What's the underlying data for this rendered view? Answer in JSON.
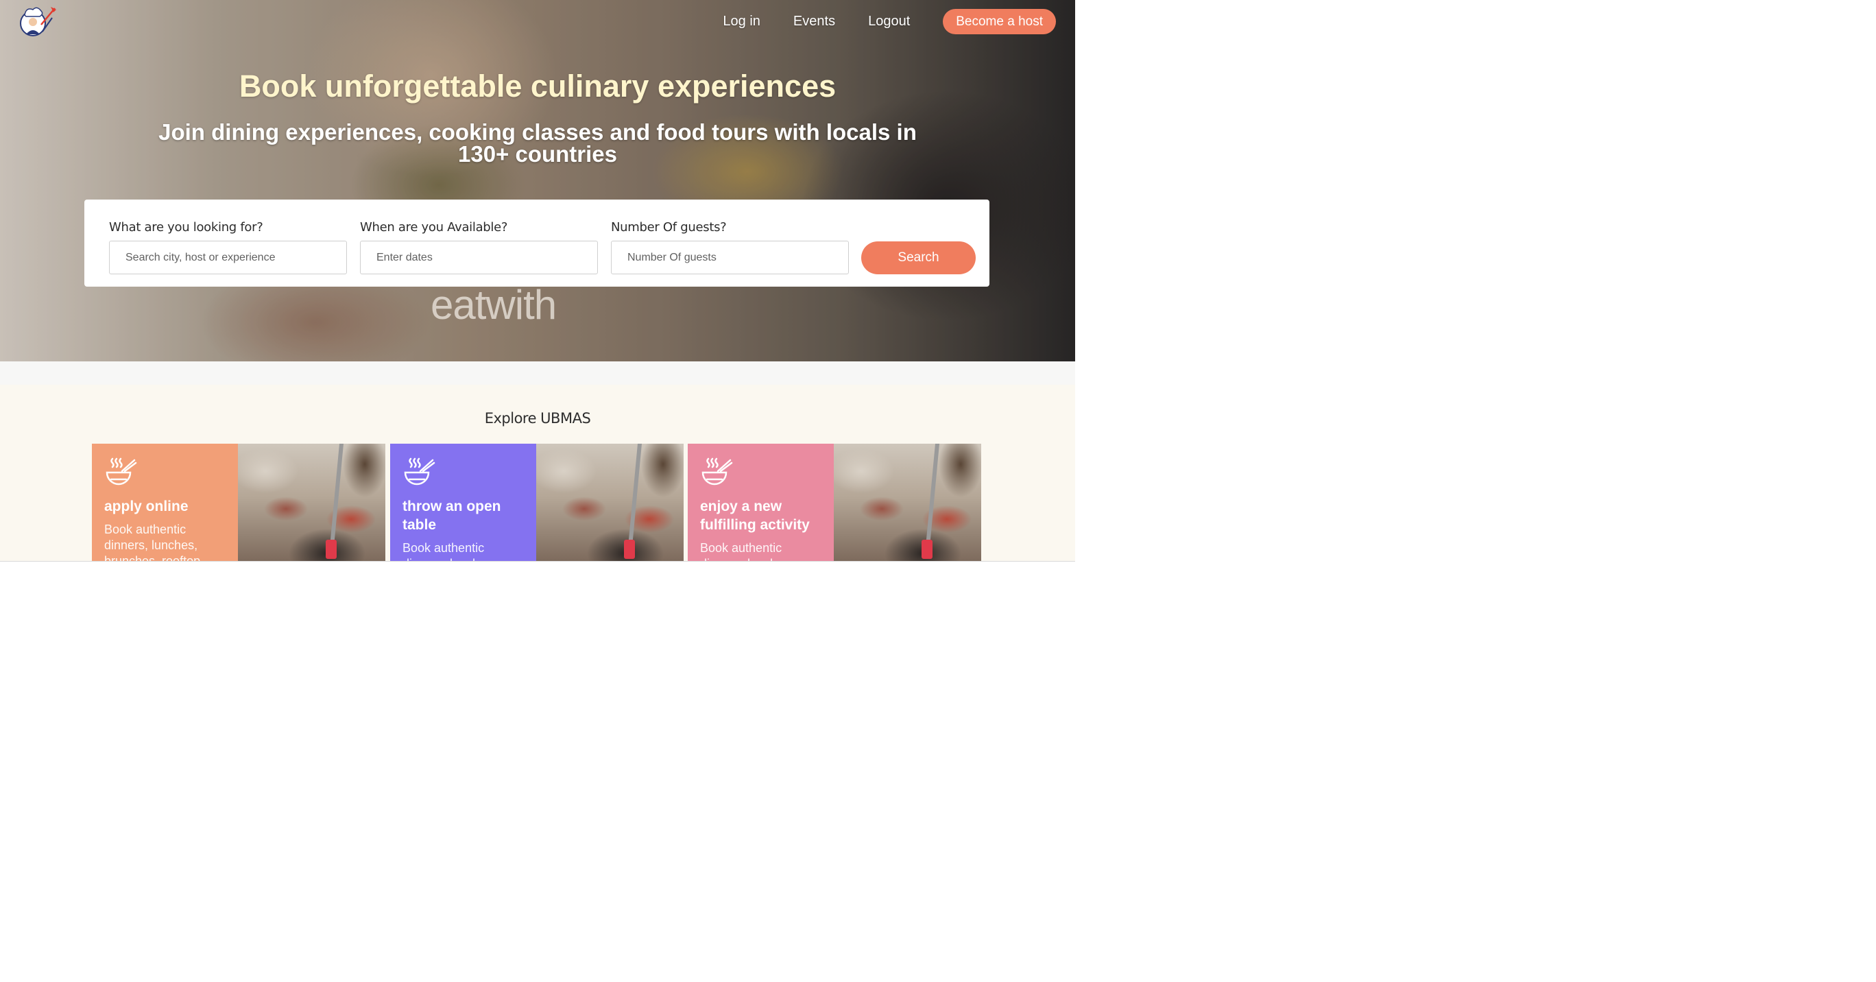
{
  "nav": {
    "links": [
      "Log in",
      "Events",
      "Logout"
    ],
    "cta_label": "Become a host"
  },
  "hero": {
    "headline": "Book unforgettable culinary experiences",
    "subhead": "Join dining experiences, cooking classes and food tours with locals in 130+ countries",
    "photo_watermark": "eatwith"
  },
  "search": {
    "what_label": "What are you looking for?",
    "what_placeholder": "Search city, host or experience",
    "when_label": "When are you Available?",
    "when_placeholder": "Enter dates",
    "guests_label": "Number Of guests?",
    "guests_placeholder": "Number Of guests",
    "button_label": "Search"
  },
  "explore": {
    "title": "Explore UBMAS",
    "cards": [
      {
        "title": "apply online",
        "desc": "Book authentic dinners, lunches, brunches, rooftop",
        "color": "#f29f77",
        "icon": "noodle-bowl-icon"
      },
      {
        "title": "throw an open table",
        "desc": "Book authentic dinners, lunches",
        "color": "#8472f0",
        "icon": "noodle-bowl-icon"
      },
      {
        "title": "enjoy a new fulfilling activity",
        "desc": "Book authentic dinners, lunches",
        "color": "#ea8ba0",
        "icon": "noodle-bowl-icon"
      }
    ]
  },
  "colors": {
    "accent": "#f07d5e",
    "headline": "#fff5cc"
  }
}
